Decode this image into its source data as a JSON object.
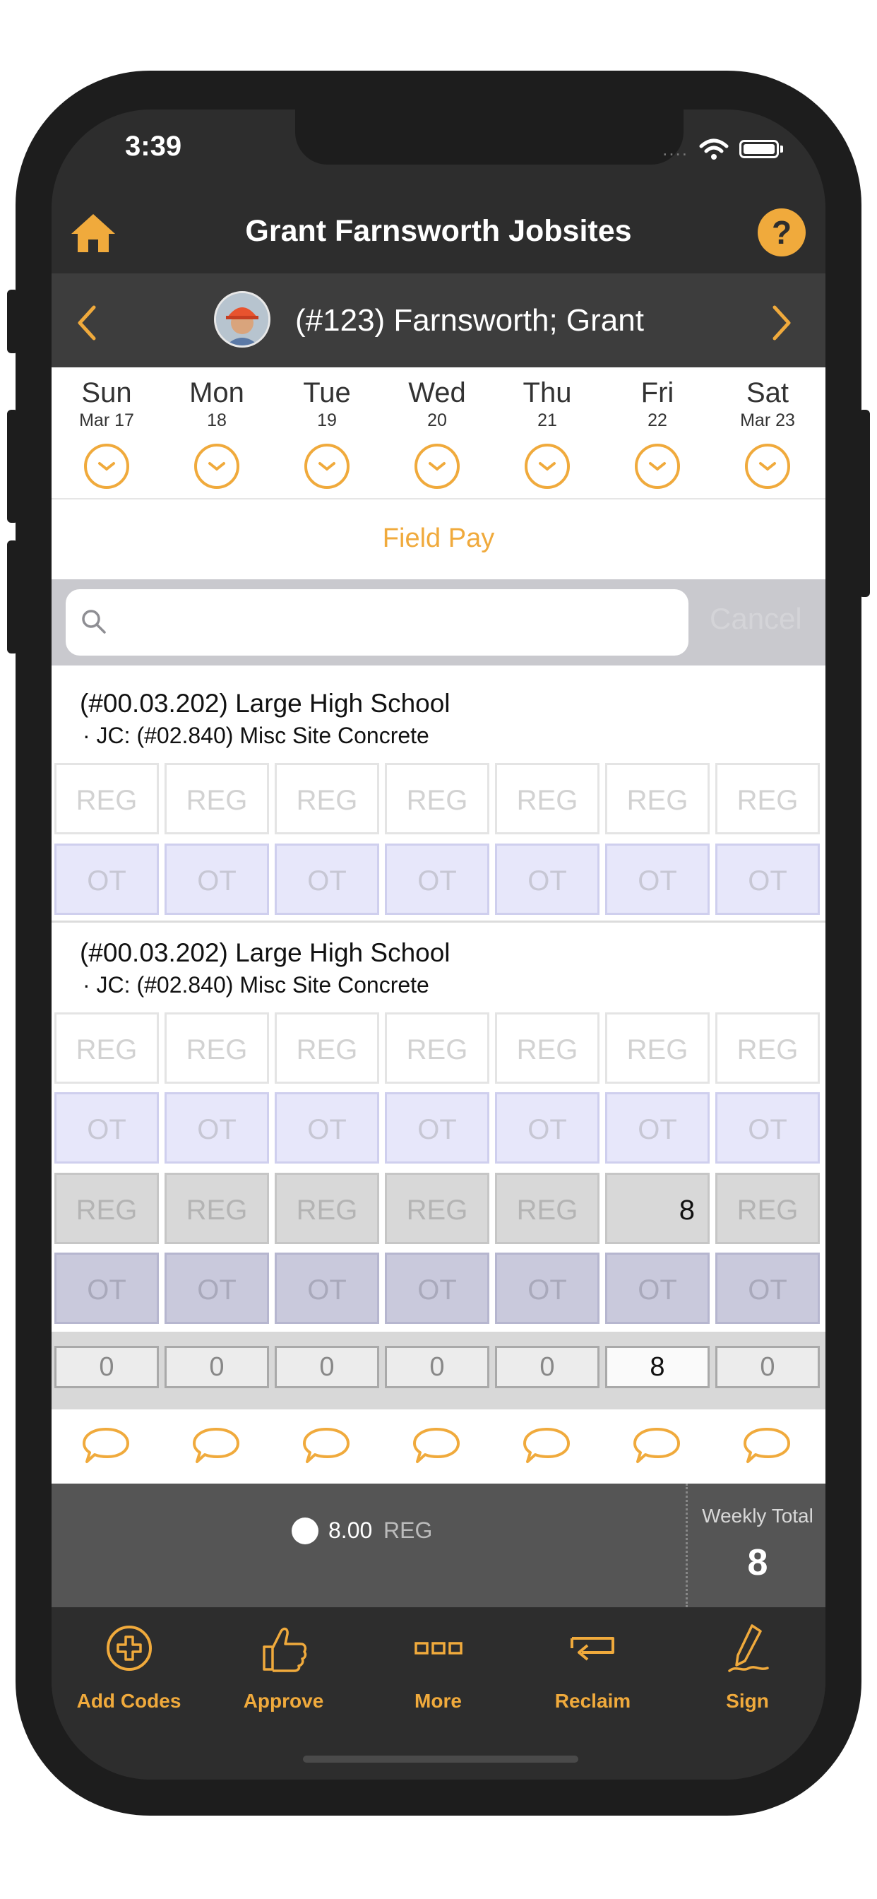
{
  "status_bar": {
    "time": "3:39",
    "signal": "....",
    "wifi_icon": "wifi-icon",
    "battery_icon": "battery-icon"
  },
  "nav": {
    "title": "Grant Farnsworth Jobsites",
    "home_icon": "home-icon",
    "help_label": "?"
  },
  "employee": {
    "name": "(#123) Farnsworth; Grant",
    "prev_icon": "chevron-left-icon",
    "next_icon": "chevron-right-icon"
  },
  "days": [
    {
      "name": "Sun",
      "date": "Mar 17"
    },
    {
      "name": "Mon",
      "date": "18"
    },
    {
      "name": "Tue",
      "date": "19"
    },
    {
      "name": "Wed",
      "date": "20"
    },
    {
      "name": "Thu",
      "date": "21"
    },
    {
      "name": "Fri",
      "date": "22"
    },
    {
      "name": "Sat",
      "date": "Mar 23"
    }
  ],
  "field_pay": "Field Pay",
  "search": {
    "placeholder": "",
    "cancel_label": "Cancel"
  },
  "groups": [
    {
      "title": "(#00.03.202) Large High School",
      "subtitle": "· JC: (#02.840) Misc Site Concrete",
      "reg": [
        "REG",
        "REG",
        "REG",
        "REG",
        "REG",
        "REG",
        "REG"
      ],
      "ot": [
        "OT",
        "OT",
        "OT",
        "OT",
        "OT",
        "OT",
        "OT"
      ]
    },
    {
      "title": "(#00.03.202) Large High School",
      "subtitle": "· JC: (#02.840) Misc Site Concrete",
      "reg": [
        "REG",
        "REG",
        "REG",
        "REG",
        "REG",
        "REG",
        "REG"
      ],
      "ot": [
        "OT",
        "OT",
        "OT",
        "OT",
        "OT",
        "OT",
        "OT"
      ]
    }
  ],
  "summary_rows": {
    "reg": [
      "REG",
      "REG",
      "REG",
      "REG",
      "REG",
      "8",
      "REG"
    ],
    "ot": [
      "OT",
      "OT",
      "OT",
      "OT",
      "OT",
      "OT",
      "OT"
    ]
  },
  "day_totals": [
    "0",
    "0",
    "0",
    "0",
    "0",
    "8",
    "0"
  ],
  "summary": {
    "value": "8.00",
    "label": "REG",
    "weekly_label": "Weekly Total",
    "weekly_value": "8"
  },
  "tabs": [
    {
      "label": "Add Codes",
      "icon": "add-circle-icon"
    },
    {
      "label": "Approve",
      "icon": "thumbs-up-icon"
    },
    {
      "label": "More",
      "icon": "more-icon"
    },
    {
      "label": "Reclaim",
      "icon": "reclaim-icon"
    },
    {
      "label": "Sign",
      "icon": "sign-icon"
    }
  ],
  "colors": {
    "accent": "#f0aa3c",
    "dark": "#2d2d2d",
    "ot_fill": "#e7e7fa"
  }
}
